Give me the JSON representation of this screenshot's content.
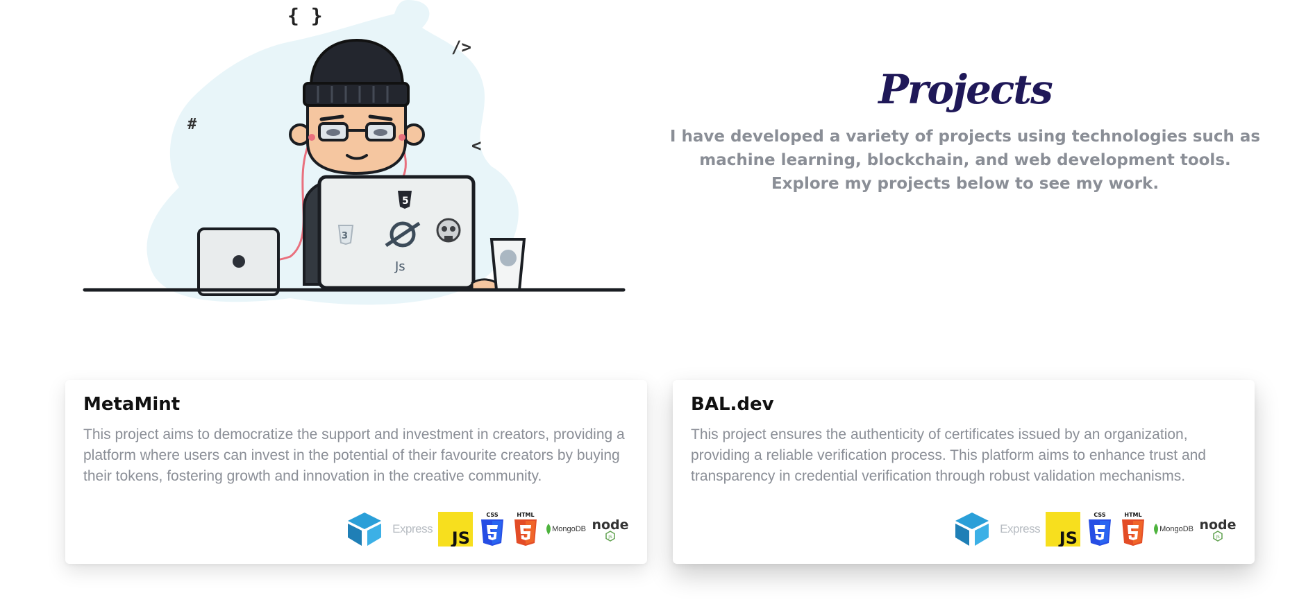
{
  "intro": {
    "title": "Projects",
    "description": "I have developed a variety of projects using technologies such as machine learning, blockchain, and web development tools. Explore my projects below to see my work."
  },
  "illustration": {
    "symbols": [
      "{ }",
      "/>",
      "#",
      "<"
    ],
    "laptop_stickers": [
      "5",
      "3",
      "Js"
    ]
  },
  "projects": [
    {
      "title": "MetaMint",
      "description": "This project aims to democratize the support and investment in creators, providing a platform where users can invest in the potential of their favourite creators by buying their tokens, fostering growth and innovation in the creative community."
    },
    {
      "title": "BAL.dev",
      "description": "This project ensures the authenticity of certificates issued by an organization, providing a reliable verification process. This platform aims to enhance trust and transparency in credential verification through robust validation mechanisms."
    }
  ],
  "tech_labels": {
    "express": "Express",
    "js": "JS",
    "css": "CSS",
    "html": "HTML",
    "mongodb": "MongoDB",
    "node": "node",
    "node_sub": "JS"
  },
  "tech_icons": [
    "blockchain-cube-icon",
    "express-icon",
    "javascript-icon",
    "css3-icon",
    "html5-icon",
    "mongodb-icon",
    "nodejs-icon"
  ],
  "colors": {
    "title": "#1f1858",
    "muted_text": "#8a8e96",
    "blob": "#e8f5f9",
    "js_yellow": "#f7df1e",
    "css_blue": "#264de4",
    "html_orange": "#e34c26",
    "node_green": "#5fa04e",
    "cube_blue": "#1f8fc9"
  }
}
